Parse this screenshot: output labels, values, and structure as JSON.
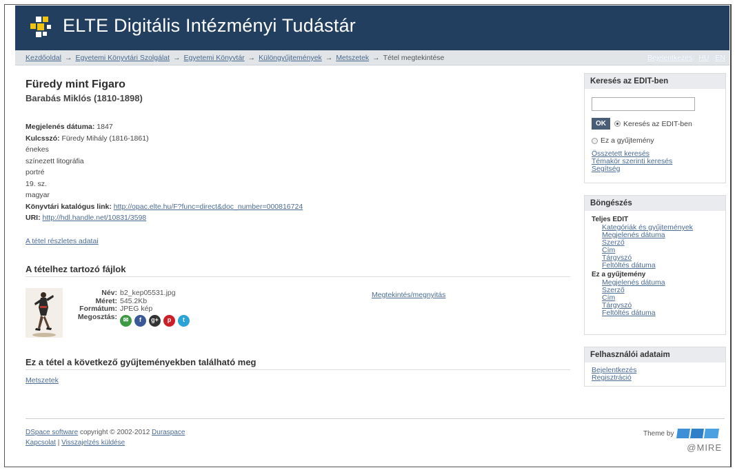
{
  "header": {
    "title": "ELTE Digitális Intézményi Tudástár"
  },
  "breadcrumb": {
    "items": [
      "Kezdőoldal",
      "Egyetemi Könyvtári Szolgálat",
      "Egyetemi Könyvtár",
      "Különgyűjtemények",
      "Metszetek"
    ],
    "current": "Tétel megtekintése",
    "separator": "→"
  },
  "topnav": {
    "login": "Bejelentkezés",
    "lang_hu": "HU",
    "lang_en": "EN"
  },
  "item": {
    "title": "Füredy mint Figaro",
    "author": "Barabás Miklós (1810-1898)",
    "date_label": "Megjelenés dátuma:",
    "date_value": "1847",
    "keyword_label": "Kulcsszó:",
    "keywords": [
      "Füredy Mihály (1816-1861)",
      "énekes",
      "színezett litográfia",
      "portré",
      "19. sz.",
      "magyar"
    ],
    "catalog_label": "Könyvtári katalógus link:",
    "catalog_url": "http://opac.elte.hu/F?func=direct&doc_number=000816724",
    "uri_label": "URI:",
    "uri_value": "http://hdl.handle.net/10831/3598",
    "details_link": "A tétel részletes adatai"
  },
  "files": {
    "heading": "A tételhez tartozó fájlok",
    "name_label": "Név:",
    "name": "b2_kep05531.jpg",
    "size_label": "Méret:",
    "size": "545.2Kb",
    "format_label": "Formátum:",
    "format": "JPEG kép",
    "share_label": "Megosztás:",
    "view_link": "Megtekintés/megnyitás",
    "share_icons": [
      "email-icon",
      "facebook-icon",
      "googleplus-icon",
      "pinterest-icon",
      "twitter-icon"
    ],
    "share_colors": [
      "#3d9a43",
      "#3b5998",
      "#333333",
      "#cb2027",
      "#2aa3d9"
    ]
  },
  "collections": {
    "heading": "Ez a tétel a következő gyűjteményekben található meg",
    "items": [
      "Metszetek"
    ]
  },
  "search": {
    "heading": "Keresés az EDIT-ben",
    "ok": "OK",
    "radio_all": "Keresés az EDIT-ben",
    "radio_coll": "Ez a gyűjtemény",
    "links": [
      "Összetett keresés",
      "Témakör szerinti keresés",
      "Segítség"
    ]
  },
  "browse": {
    "heading": "Böngészés",
    "group1": "Teljes EDIT",
    "group1_links": [
      "Kategóriák és gyűjtemények",
      "Megjelenés dátuma",
      "Szerző",
      "Cím",
      "Tárgyszó",
      "Feltöltés dátuma"
    ],
    "group2": "Ez a gyűjtemény",
    "group2_links": [
      "Megjelenés dátuma",
      "Szerző",
      "Cím",
      "Tárgyszó",
      "Feltöltés dátuma"
    ]
  },
  "user": {
    "heading": "Felhasználói adataim",
    "links": [
      "Bejelentkezés",
      "Regisztráció"
    ]
  },
  "footer": {
    "dspace": "DSpace software",
    "copyright": "copyright © 2002-2012",
    "duraspace": "Duraspace",
    "contact": "Kapcsolat",
    "sep": "|",
    "feedback": "Visszajelzés küldése",
    "theme_by": "Theme by",
    "atmire": "@MIRE"
  },
  "colors": {
    "banner": "#233f60",
    "link": "#4a6b94",
    "logo_yellow": "#f1c40f",
    "logo_white": "#ffffff"
  }
}
